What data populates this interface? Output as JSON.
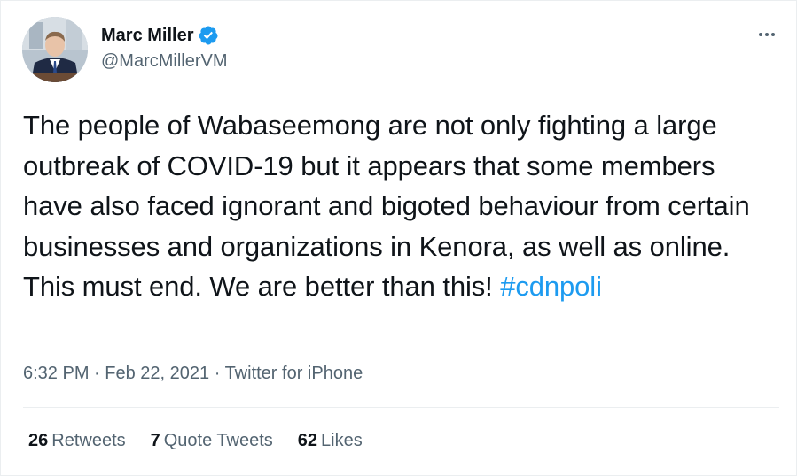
{
  "user": {
    "name": "Marc Miller",
    "handle": "@MarcMillerVM",
    "verified_color": "#1d9bf0"
  },
  "tweet": {
    "text_main": "The people of Wabaseemong are not only fighting a large outbreak of COVID-19 but it appears that some members have also faced ignorant and bigoted behaviour from certain businesses and organizations in Kenora, as well as online. This must end. We are better than this!",
    "hashtag": "#cdnpoli"
  },
  "meta": {
    "time": "6:32 PM",
    "sep1": " · ",
    "date": "Feb 22, 2021",
    "sep2": " · ",
    "source": "Twitter for iPhone"
  },
  "stats": {
    "retweets_count": "26",
    "retweets_label": "Retweets",
    "quotes_count": "7",
    "quotes_label": "Quote Tweets",
    "likes_count": "62",
    "likes_label": "Likes"
  },
  "icons": {
    "more": "more-icon",
    "verified": "verified-badge-icon"
  },
  "colors": {
    "accent": "#1d9bf0",
    "text": "#0f1419",
    "secondary": "#536471",
    "divider": "#ebeef0"
  }
}
